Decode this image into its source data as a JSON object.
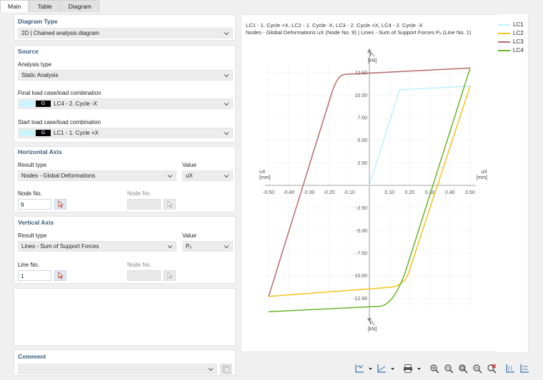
{
  "tabs": [
    "Main",
    "Table",
    "Diagram"
  ],
  "diagram_type": {
    "title": "Diagram Type",
    "value": "2D | Chained analysis diagram"
  },
  "source": {
    "title": "Source",
    "analysis_type_label": "Analysis type",
    "analysis_type_value": "Static Analysis",
    "final_label": "Final load case/load combination",
    "final_value": "LC4 - 2. Cycle -X",
    "start_label": "Start load case/load combination",
    "start_value": "LC1 - 1. Cycle +X",
    "lc_badge": "G"
  },
  "horizontal_axis": {
    "title": "Horizontal Axis",
    "result_type_label": "Result type",
    "result_type_value": "Nodes - Global Deformations",
    "value_label": "Value",
    "value_value": "uX",
    "node_label": "Node No.",
    "node_value": "9",
    "node2_label": "Node No.",
    "node2_value": ""
  },
  "vertical_axis": {
    "title": "Vertical Axis",
    "result_type_label": "Result type",
    "result_type_value": "Lines - Sum of Support Forces",
    "value_label": "Value",
    "value_value": "Pₓ",
    "line_label": "Line No.",
    "line_value": "1",
    "node_label": "Node No.",
    "node_value": ""
  },
  "comment": {
    "title": "Comment",
    "value": ""
  },
  "chart_header": {
    "line1": "LC1 - 1. Cycle +X, LC2 - 1. Cycle -X, LC3 - 2. Cycle +X, LC4 - 2. Cycle -X",
    "line2": "Nodes - Global Deformations uX (Node No. 9) | Lines - Sum of Support Forces Pₓ (Line No. 1)"
  },
  "axis_labels": {
    "x_left": "uX\n[mm]",
    "x_right": "uX\n[mm]",
    "y_top": "Pₓ\n[kN]",
    "y_bottom": "Pₓ\n[kN]"
  },
  "chart_data": {
    "type": "line",
    "xlim": [
      -0.5,
      0.5
    ],
    "ylim": [
      -12.5,
      12.5
    ],
    "x_ticks": [
      "-0.50",
      "-0.40",
      "-0.30",
      "-0.20",
      "-0.10",
      "0.10",
      "0.20",
      "0.30",
      "0.40",
      "0.50"
    ],
    "y_ticks": [
      "12.50",
      "10.00",
      "7.50",
      "5.00",
      "2.50",
      "-2.50",
      "-5.00",
      "-7.50",
      "-10.00",
      "-12.50"
    ],
    "grid": true,
    "legend_position": "right",
    "series": [
      {
        "name": "LC1",
        "color": "#b9f1fa",
        "x": [
          0.0,
          0.15,
          0.5
        ],
        "y": [
          0.0,
          10.6,
          11.0
        ]
      },
      {
        "name": "LC2",
        "color": "#f5c31b",
        "x": [
          0.5,
          0.15,
          -0.5
        ],
        "y": [
          11.0,
          -11.2,
          -12.3
        ]
      },
      {
        "name": "LC3",
        "color": "#b86a6a",
        "x": [
          -0.5,
          -0.16,
          0.5
        ],
        "y": [
          -12.3,
          12.3,
          13.0
        ]
      },
      {
        "name": "LC4",
        "color": "#6ab42a",
        "x": [
          0.5,
          0.12,
          -0.5
        ],
        "y": [
          13.0,
          -13.3,
          -14.0
        ]
      }
    ]
  },
  "toolbar_icons": [
    "axis-settings-icon",
    "axis-settings-dropdown-icon",
    "axis2-settings-icon",
    "axis2-settings-dropdown-icon",
    "print-icon",
    "print-dropdown-icon",
    "zoom-in-icon",
    "zoom-out-icon",
    "zoom-all-icon",
    "zoom-window-icon",
    "reset-zoom-icon",
    "axis-x-icon",
    "axis-y-icon"
  ]
}
